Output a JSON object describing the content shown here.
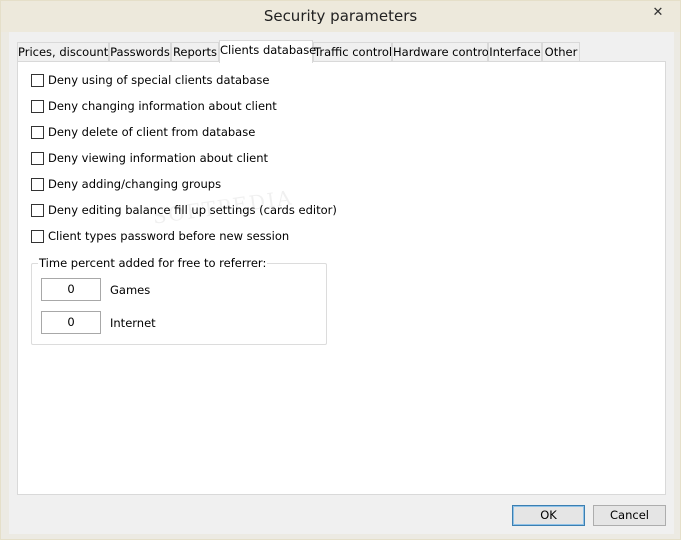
{
  "window": {
    "title": "Security parameters",
    "close_glyph": "✕"
  },
  "tabs": [
    {
      "label": "Prices, discounts",
      "active": false
    },
    {
      "label": "Passwords",
      "active": false
    },
    {
      "label": "Reports",
      "active": false
    },
    {
      "label": "Clients database",
      "active": true
    },
    {
      "label": "Traffic control",
      "active": false
    },
    {
      "label": "Hardware control",
      "active": false
    },
    {
      "label": "Interface",
      "active": false
    },
    {
      "label": "Other",
      "active": false
    }
  ],
  "checkboxes": [
    {
      "label": "Deny using of special clients database",
      "checked": false
    },
    {
      "label": "Deny changing information about client",
      "checked": false
    },
    {
      "label": "Deny delete of client from database",
      "checked": false
    },
    {
      "label": "Deny viewing information about client",
      "checked": false
    },
    {
      "label": "Deny adding/changing groups",
      "checked": false
    },
    {
      "label": "Deny editing balance fill up settings (cards editor)",
      "checked": false
    },
    {
      "label": "Client types password before new session",
      "checked": false
    }
  ],
  "referrer_group": {
    "legend": "Time percent added for free to referrer:",
    "fields": [
      {
        "value": "0",
        "label": "Games"
      },
      {
        "value": "0",
        "label": "Internet"
      }
    ]
  },
  "buttons": {
    "ok": "OK",
    "cancel": "Cancel"
  },
  "watermark": "SOFTPEDIA",
  "colors": {
    "tab_border": "#d9d9d9",
    "default_button_border": "#3c7fb1",
    "titlebar": "#ede9dc"
  }
}
